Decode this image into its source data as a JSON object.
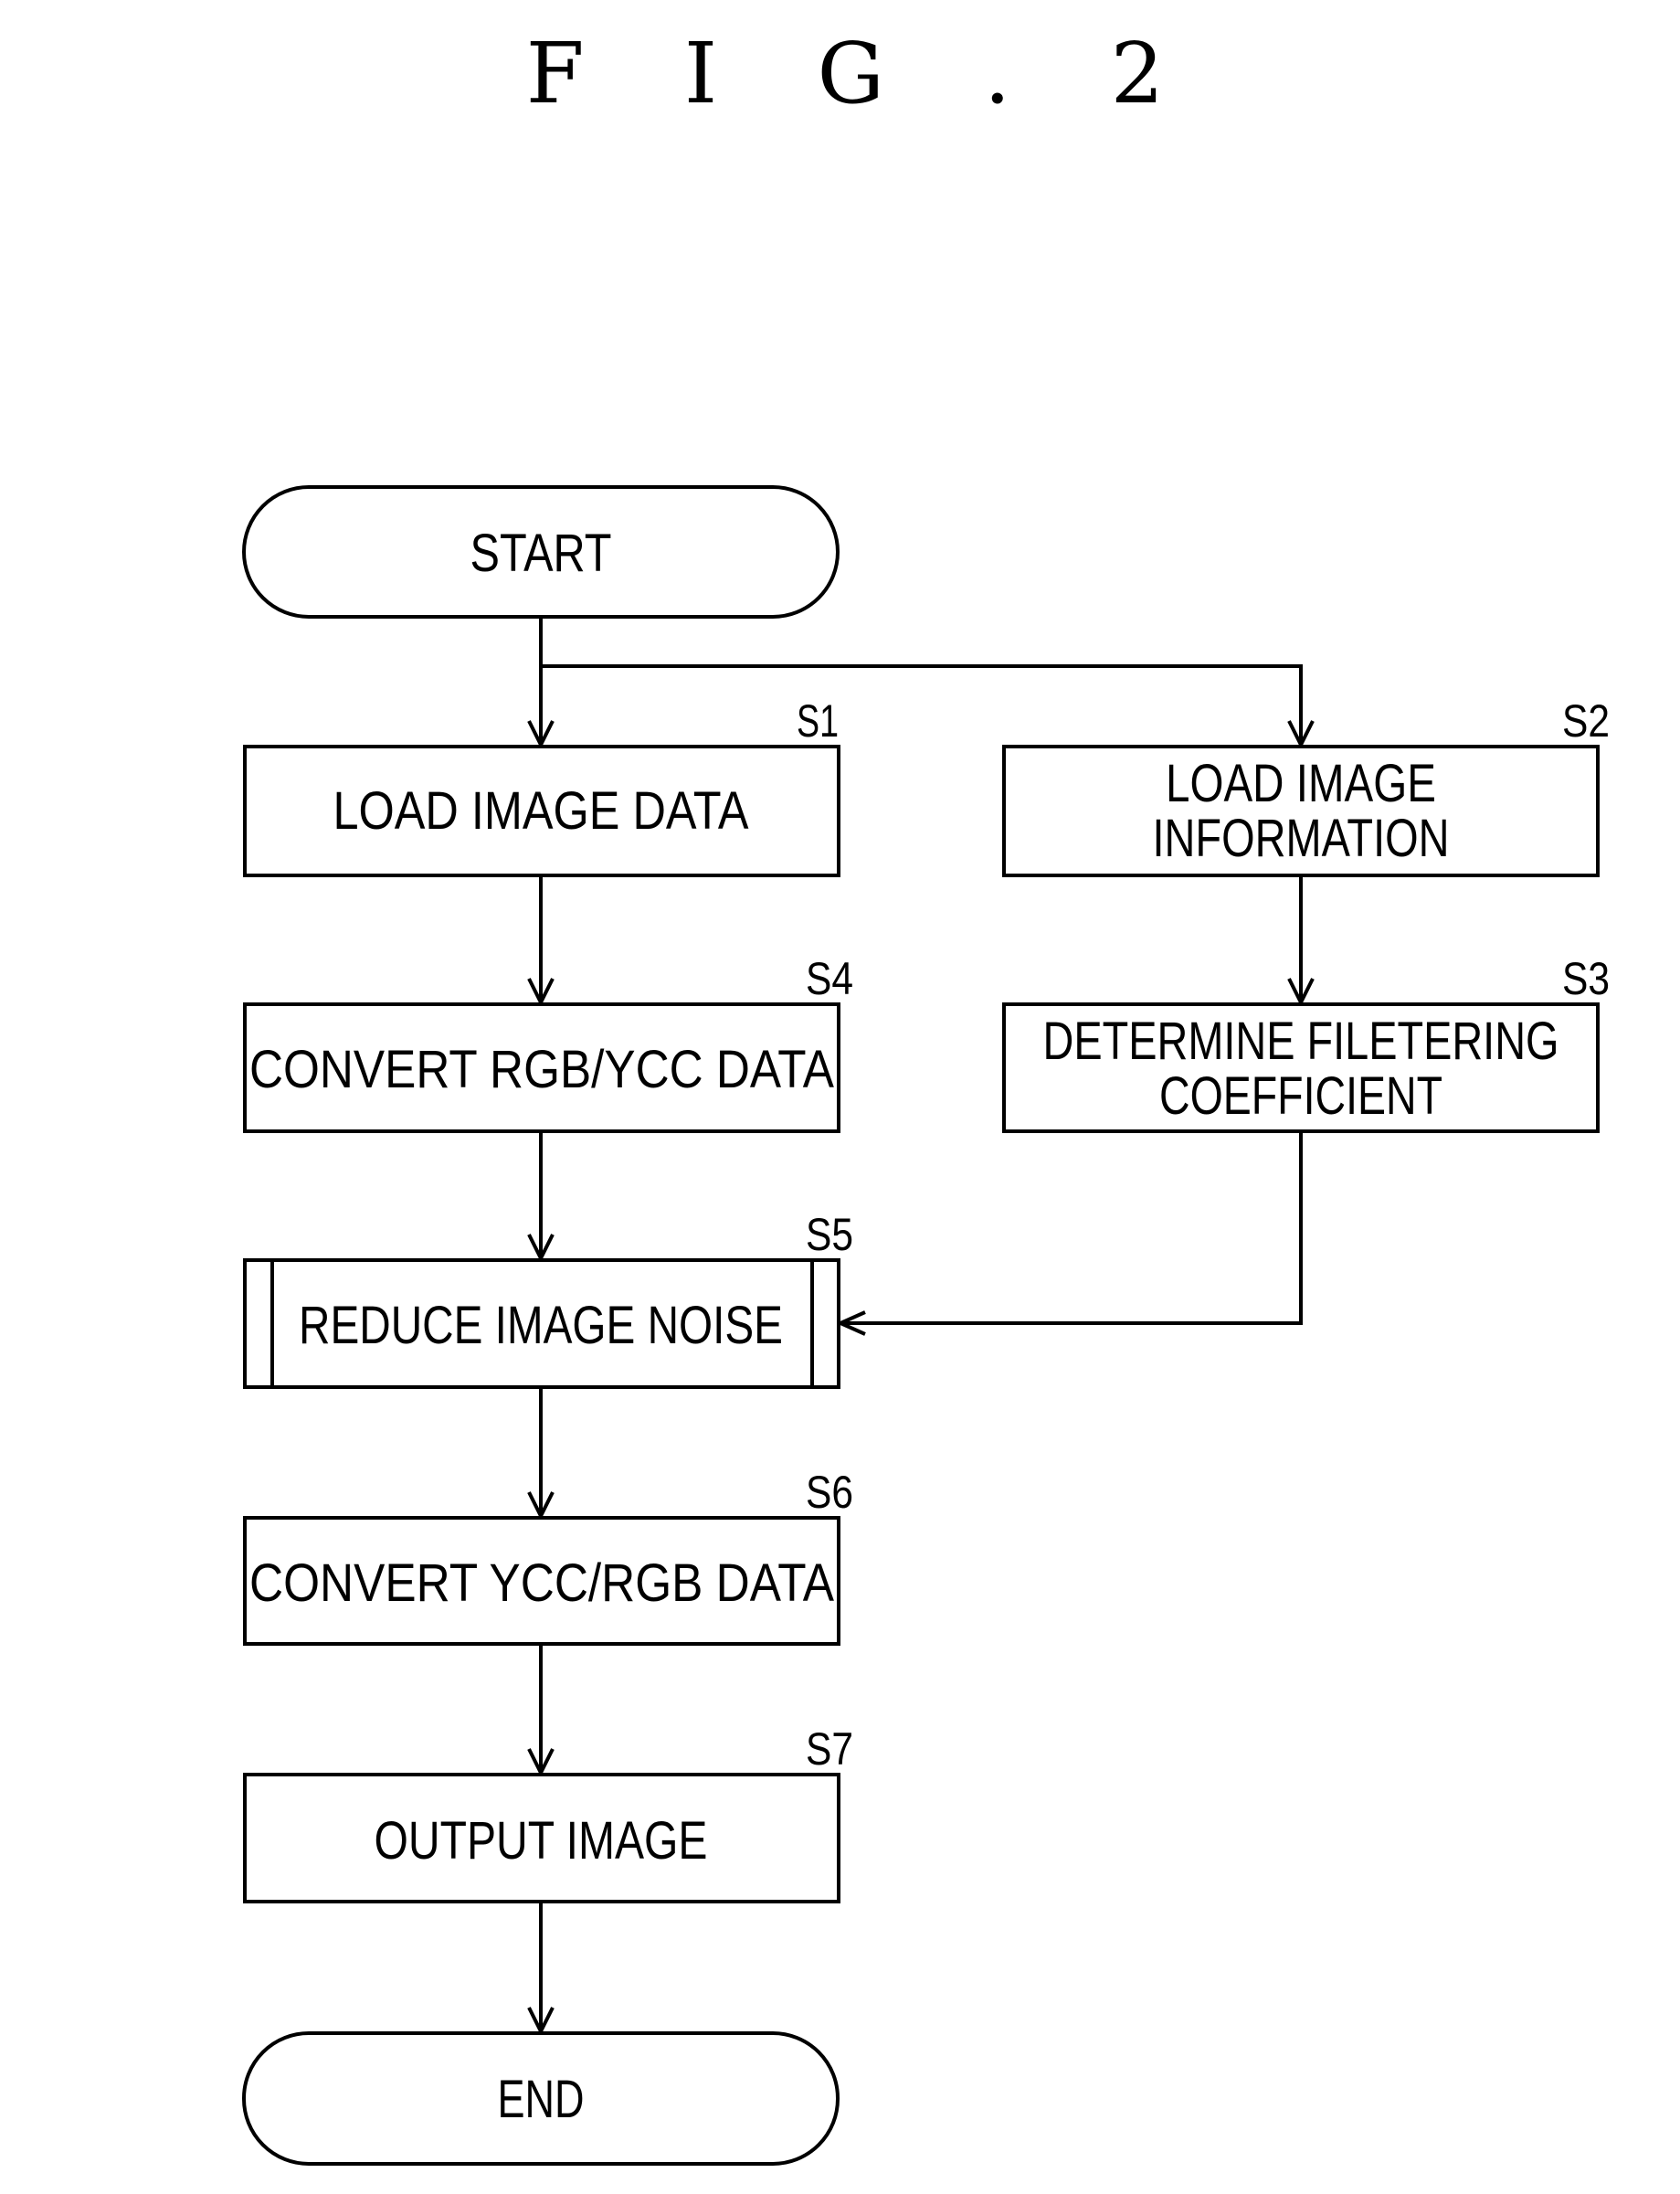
{
  "figure": {
    "title": "F I G . 2"
  },
  "nodes": {
    "start": {
      "label": "START",
      "type": "terminal"
    },
    "s1": {
      "step": "S1",
      "lines": [
        "LOAD IMAGE DATA"
      ],
      "type": "process"
    },
    "s2": {
      "step": "S2",
      "lines": [
        "LOAD IMAGE",
        "INFORMATION"
      ],
      "type": "process"
    },
    "s3": {
      "step": "S3",
      "lines": [
        "DETERMINE FILETERING",
        "COEFFICIENT"
      ],
      "type": "process"
    },
    "s4": {
      "step": "S4",
      "lines": [
        "CONVERT RGB/YCC DATA"
      ],
      "type": "process"
    },
    "s5": {
      "step": "S5",
      "lines": [
        "REDUCE IMAGE NOISE"
      ],
      "type": "predefined-process"
    },
    "s6": {
      "step": "S6",
      "lines": [
        "CONVERT YCC/RGB DATA"
      ],
      "type": "process"
    },
    "s7": {
      "step": "S7",
      "lines": [
        "OUTPUT IMAGE"
      ],
      "type": "process"
    },
    "end": {
      "label": "END",
      "type": "terminal"
    }
  },
  "edges": [
    {
      "from": "start",
      "to": "s1"
    },
    {
      "from": "start",
      "to": "s2"
    },
    {
      "from": "s1",
      "to": "s4"
    },
    {
      "from": "s2",
      "to": "s3"
    },
    {
      "from": "s4",
      "to": "s5"
    },
    {
      "from": "s3",
      "to": "s5"
    },
    {
      "from": "s5",
      "to": "s6"
    },
    {
      "from": "s6",
      "to": "s7"
    },
    {
      "from": "s7",
      "to": "end"
    }
  ]
}
